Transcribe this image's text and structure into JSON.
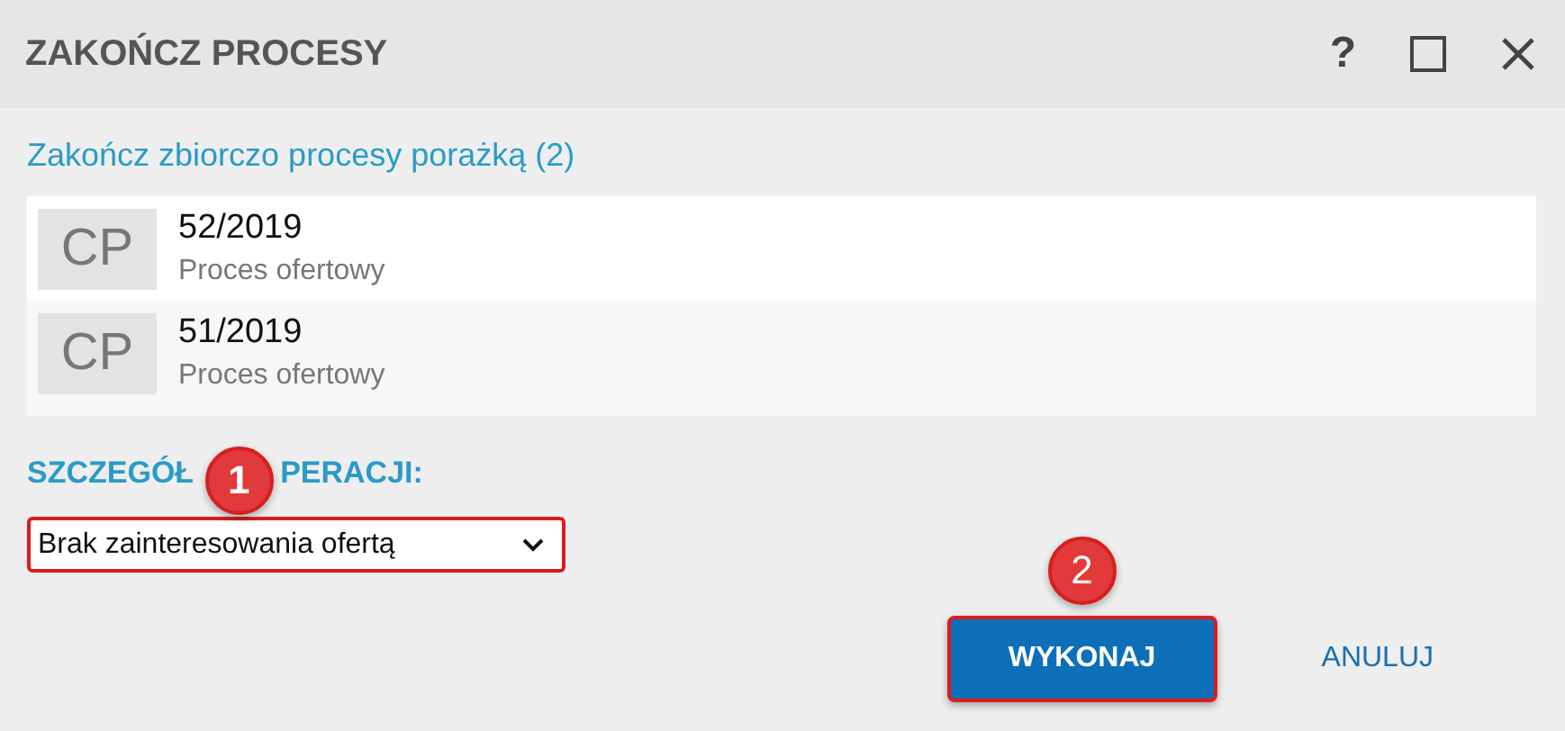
{
  "window": {
    "title": "ZAKOŃCZ PROCESY",
    "controls": [
      {
        "kind": "help",
        "label": "?"
      },
      {
        "kind": "maximize"
      },
      {
        "kind": "close"
      }
    ]
  },
  "subtitle": "Zakończ zbiorczo procesy porażką (2)",
  "items": [
    {
      "avatar": "CP",
      "number": "52/2019",
      "type": "Proces ofertowy"
    },
    {
      "avatar": "CP",
      "number": "51/2019",
      "type": "Proces ofertowy"
    }
  ],
  "details": {
    "heading_parts": [
      "SZCZEGÓŁ",
      "PERACJI:"
    ],
    "marker": "1",
    "select": {
      "value": "Brak zainteresowania ofertą",
      "highlighted": true
    }
  },
  "buttons": [
    {
      "kind": "primary",
      "label": "WYKONAJ",
      "marker": "2",
      "highlighted": true
    },
    {
      "kind": "link",
      "label": "ANULUJ",
      "highlighted": false
    }
  ]
}
